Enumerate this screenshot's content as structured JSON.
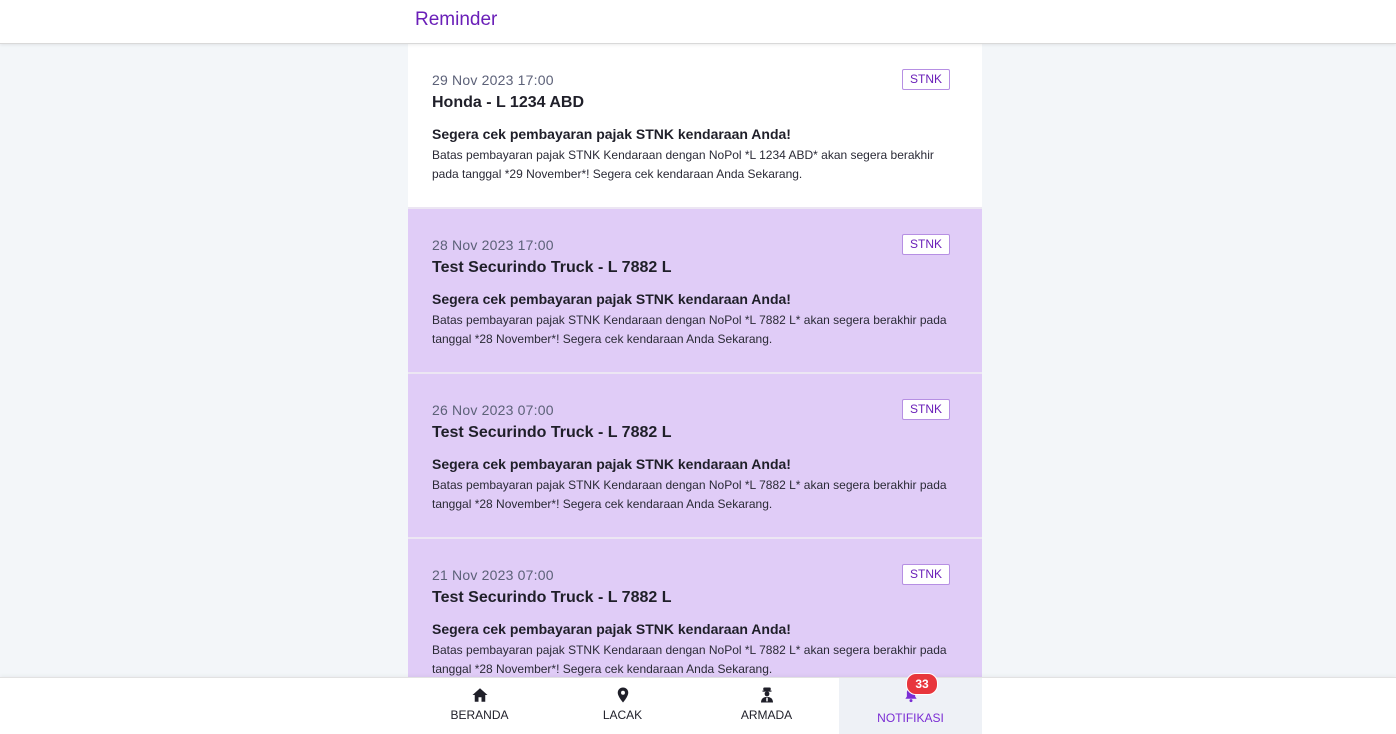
{
  "header": {
    "title": "Reminder"
  },
  "notifications": [
    {
      "date": "29 Nov 2023 17:00",
      "badge": "STNK",
      "title": "Honda - L 1234 ABD",
      "heading": "Segera cek pembayaran pajak STNK kendaraan Anda!",
      "body": "Batas pembayaran pajak STNK Kendaraan dengan NoPol *L 1234 ABD* akan segera berakhir pada tanggal *29 November*! Segera cek kendaraan Anda Sekarang.",
      "read": true
    },
    {
      "date": "28 Nov 2023 17:00",
      "badge": "STNK",
      "title": "Test Securindo Truck - L 7882 L",
      "heading": "Segera cek pembayaran pajak STNK kendaraan Anda!",
      "body": "Batas pembayaran pajak STNK Kendaraan dengan NoPol *L 7882 L* akan segera berakhir pada tanggal *28 November*! Segera cek kendaraan Anda Sekarang.",
      "read": false
    },
    {
      "date": "26 Nov 2023 07:00",
      "badge": "STNK",
      "title": "Test Securindo Truck - L 7882 L",
      "heading": "Segera cek pembayaran pajak STNK kendaraan Anda!",
      "body": "Batas pembayaran pajak STNK Kendaraan dengan NoPol *L 7882 L* akan segera berakhir pada tanggal *28 November*! Segera cek kendaraan Anda Sekarang.",
      "read": false
    },
    {
      "date": "21 Nov 2023 07:00",
      "badge": "STNK",
      "title": "Test Securindo Truck - L 7882 L",
      "heading": "Segera cek pembayaran pajak STNK kendaraan Anda!",
      "body": "Batas pembayaran pajak STNK Kendaraan dengan NoPol *L 7882 L* akan segera berakhir pada tanggal *28 November*! Segera cek kendaraan Anda Sekarang.",
      "read": false
    }
  ],
  "nav": {
    "items": [
      {
        "label": "BERANDA",
        "icon": "home-icon"
      },
      {
        "label": "LACAK",
        "icon": "location-pin-icon"
      },
      {
        "label": "ARMADA",
        "icon": "driver-icon"
      },
      {
        "label": "NOTIFIKASI",
        "icon": "bell-icon",
        "active": true
      }
    ],
    "badge_count": "33"
  },
  "colors": {
    "brand": "#6a1fb8",
    "unread_bg": "#e0ccf7",
    "badge_red": "#e8363c"
  }
}
